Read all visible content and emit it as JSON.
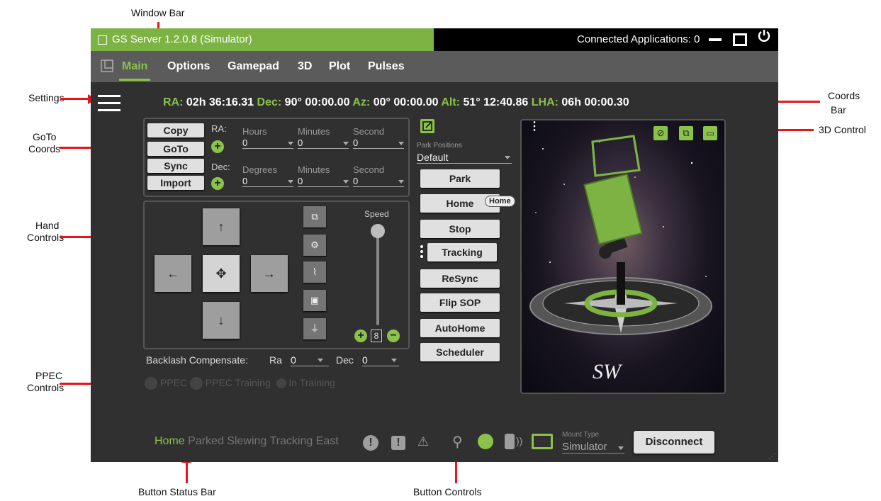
{
  "annotations": {
    "window_bar": "Window Bar",
    "settings": "Settings",
    "goto_coords_1": "GoTo",
    "goto_coords_2": "Coords",
    "hand_controls_1": "Hand",
    "hand_controls_2": "Controls",
    "ppec_controls_1": "PPEC",
    "ppec_controls_2": "Controls",
    "coords_bar_1": "Coords",
    "coords_bar_2": "Bar",
    "control_3d": "3D Control",
    "button_status_bar": "Button Status Bar",
    "button_controls": "Button Controls"
  },
  "window": {
    "title": "GS Server 1.2.0.8 (Simulator)",
    "connected_apps": "Connected Applications: 0",
    "title_bg": "#7cb342"
  },
  "tabs": [
    "Main",
    "Options",
    "Gamepad",
    "3D",
    "Plot",
    "Pulses"
  ],
  "coords": {
    "ra_label": "RA:",
    "ra": "02h 36:16.31",
    "dec_label": "Dec:",
    "dec": "90° 00:00.00",
    "az_label": "Az:",
    "az": "00° 00:00.00",
    "alt_label": "Alt:",
    "alt": "51° 12:40.86",
    "lha_label": "LHA:",
    "lha": "06h 00:00.30"
  },
  "goto": {
    "buttons": [
      "Copy",
      "GoTo",
      "Sync",
      "Import"
    ],
    "ra_label": "RA:",
    "dec_label": "Dec:",
    "ra_fields": [
      {
        "label": "Hours",
        "value": "0"
      },
      {
        "label": "Minutes",
        "value": "0"
      },
      {
        "label": "Second",
        "value": "0"
      }
    ],
    "dec_fields": [
      {
        "label": "Degrees",
        "value": "0"
      },
      {
        "label": "Minutes",
        "value": "0"
      },
      {
        "label": "Second",
        "value": "0"
      }
    ]
  },
  "hand": {
    "speed_label": "Speed",
    "speed_value": "8"
  },
  "backlash": {
    "label": "Backlash Compensate:",
    "ra_label": "Ra",
    "ra_value": "0",
    "dec_label": "Dec",
    "dec_value": "0"
  },
  "ppec": {
    "ppec": "PPEC",
    "ppec_training": "PPEC Training",
    "in_training": "In Training"
  },
  "park": {
    "label": "Park Positions",
    "value": "Default",
    "home_badge": "Home"
  },
  "buttons": [
    "Park",
    "Home",
    "Stop",
    "Tracking",
    "ReSync",
    "Flip SOP",
    "AutoHome",
    "Scheduler"
  ],
  "status_bar": {
    "items": [
      "Home",
      "Parked",
      "Slewing",
      "Tracking",
      "East"
    ],
    "active_color": "#8bc34a",
    "mount_type_label": "Mount Type",
    "mount_type_value": "Simulator",
    "disconnect": "Disconnect"
  },
  "view3d": {
    "logo": "SW"
  }
}
